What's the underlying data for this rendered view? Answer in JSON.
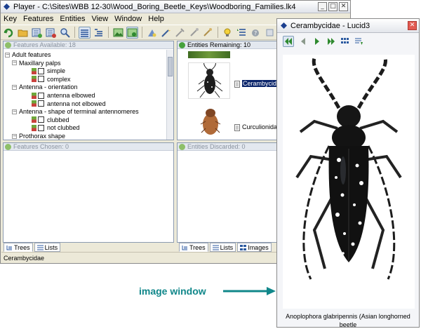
{
  "main_window": {
    "title": "Player - C:\\Sites\\WBB 12-30\\Wood_Boring_Beetle_Keys\\Woodboring_Families.lk4",
    "menu": [
      "Key",
      "Features",
      "Entities",
      "View",
      "Window",
      "Help"
    ]
  },
  "panes": {
    "features_available": "Features Available: 18",
    "entities_remaining": "Entities Remaining: 10",
    "features_chosen": "Features Chosen: 0",
    "entities_discarded": "Entities Discarded: 0"
  },
  "features_tree": [
    {
      "label": "Adult features",
      "level": 0,
      "kind": "group"
    },
    {
      "label": "Maxillary palps",
      "level": 1,
      "kind": "group"
    },
    {
      "label": "simple",
      "level": 2,
      "kind": "state"
    },
    {
      "label": "complex",
      "level": 2,
      "kind": "state"
    },
    {
      "label": "Antenna - orientation",
      "level": 1,
      "kind": "group"
    },
    {
      "label": "antenna elbowed",
      "level": 2,
      "kind": "state"
    },
    {
      "label": "antenna not elbowed",
      "level": 2,
      "kind": "state"
    },
    {
      "label": "Antenna - shape of terminal antennomeres",
      "level": 1,
      "kind": "group"
    },
    {
      "label": "clubbed",
      "level": 2,
      "kind": "state"
    },
    {
      "label": "not clubbed",
      "level": 2,
      "kind": "state"
    },
    {
      "label": "Prothorax shape",
      "level": 1,
      "kind": "group"
    }
  ],
  "entities": [
    {
      "label": "Cerambycidae",
      "selected": true
    },
    {
      "label": "Curculionidae",
      "selected": false
    }
  ],
  "left_tabs": [
    "Trees",
    "Lists"
  ],
  "right_tabs": [
    "Trees",
    "Lists",
    "Images"
  ],
  "status_text": "Cerambycidae",
  "image_window": {
    "title": "Cerambycidae - Lucid3",
    "caption": "Anoplophora glabripennis (Asian longhorned beetle"
  },
  "callout": "image window",
  "colors": {
    "accent": "#10878a",
    "selection": "#0a246a",
    "pane_border": "#8c9bb0",
    "window_bg": "#ece9d8"
  }
}
